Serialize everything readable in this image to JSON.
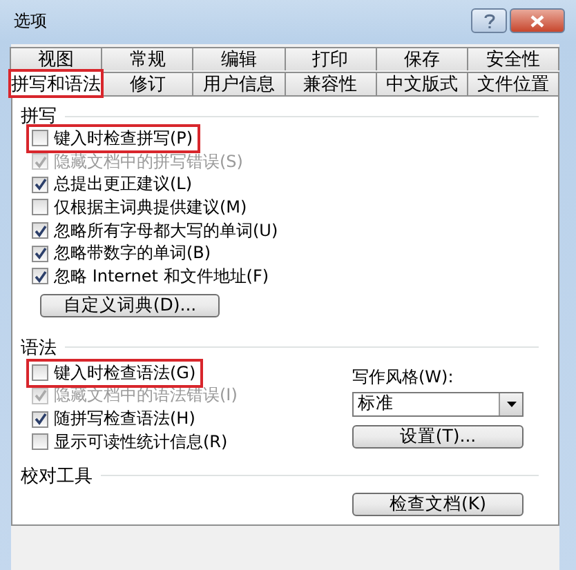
{
  "window": {
    "title": "选项"
  },
  "tab_rows": [
    [
      {
        "label": "视图",
        "selected": false,
        "highlighted": false
      },
      {
        "label": "常规",
        "selected": false,
        "highlighted": false
      },
      {
        "label": "编辑",
        "selected": false,
        "highlighted": false
      },
      {
        "label": "打印",
        "selected": false,
        "highlighted": false
      },
      {
        "label": "保存",
        "selected": false,
        "highlighted": false
      },
      {
        "label": "安全性",
        "selected": false,
        "highlighted": false
      }
    ],
    [
      {
        "label": "拼写和语法",
        "selected": true,
        "highlighted": true
      },
      {
        "label": "修订",
        "selected": false,
        "highlighted": false
      },
      {
        "label": "用户信息",
        "selected": false,
        "highlighted": false
      },
      {
        "label": "兼容性",
        "selected": false,
        "highlighted": false
      },
      {
        "label": "中文版式",
        "selected": false,
        "highlighted": false
      },
      {
        "label": "文件位置",
        "selected": false,
        "highlighted": false
      }
    ]
  ],
  "spelling": {
    "title": "拼写",
    "options": [
      {
        "label": "键入时检查拼写(P)",
        "checked": false,
        "disabled": false,
        "highlighted": true
      },
      {
        "label": "隐藏文档中的拼写错误(S)",
        "checked": true,
        "disabled": true,
        "highlighted": false
      },
      {
        "label": "总提出更正建议(L)",
        "checked": true,
        "disabled": false,
        "highlighted": false
      },
      {
        "label": "仅根据主词典提供建议(M)",
        "checked": false,
        "disabled": false,
        "highlighted": false
      },
      {
        "label": "忽略所有字母都大写的单词(U)",
        "checked": true,
        "disabled": false,
        "highlighted": false
      },
      {
        "label": "忽略带数字的单词(B)",
        "checked": true,
        "disabled": false,
        "highlighted": false
      },
      {
        "label": "忽略 Internet 和文件地址(F)",
        "checked": true,
        "disabled": false,
        "highlighted": false
      }
    ],
    "button": "自定义词典(D)..."
  },
  "grammar": {
    "title": "语法",
    "options": [
      {
        "label": "键入时检查语法(G)",
        "checked": false,
        "disabled": false,
        "highlighted": true
      },
      {
        "label": "隐藏文档中的语法错误(I)",
        "checked": true,
        "disabled": true,
        "highlighted": false
      },
      {
        "label": "随拼写检查语法(H)",
        "checked": true,
        "disabled": false,
        "highlighted": false
      },
      {
        "label": "显示可读性统计信息(R)",
        "checked": false,
        "disabled": false,
        "highlighted": false
      }
    ],
    "style_label": "写作风格(W):",
    "style_value": "标准",
    "settings_button": "设置(T)..."
  },
  "proofing": {
    "title": "校对工具",
    "button": "检查文档(K)"
  }
}
